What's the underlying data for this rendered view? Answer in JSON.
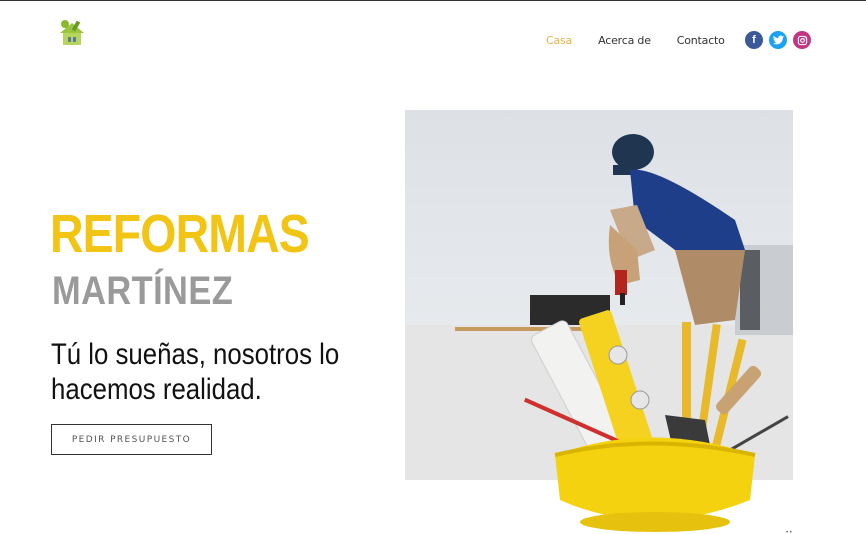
{
  "brand": {
    "logo_icon": "house-worker-logo-icon"
  },
  "nav": {
    "items": [
      {
        "label": "Casa",
        "active": true
      },
      {
        "label": "Acerca de",
        "active": false
      },
      {
        "label": "Contacto",
        "active": false
      }
    ],
    "active_color": "#e6b34a"
  },
  "social": {
    "facebook": {
      "icon": "facebook-icon",
      "glyph": "f",
      "color": "#3b5998"
    },
    "twitter": {
      "icon": "twitter-icon",
      "glyph": "t",
      "color": "#1da1f2"
    },
    "instagram": {
      "icon": "instagram-icon",
      "glyph": "◎",
      "color": "#c13584"
    }
  },
  "hero": {
    "title": "REFORMAS",
    "subtitle": "MARTÍNEZ",
    "tagline": "Tú lo sueñas, nosotros lo hacemos realidad.",
    "cta_label": "PEDIR PRESUPUESTO",
    "title_color": "#f2c414",
    "subtitle_color": "#9a9a9a"
  },
  "media": {
    "photo": "construction-worker-photo",
    "overlay": "tools-in-yellow-helmet-image"
  }
}
